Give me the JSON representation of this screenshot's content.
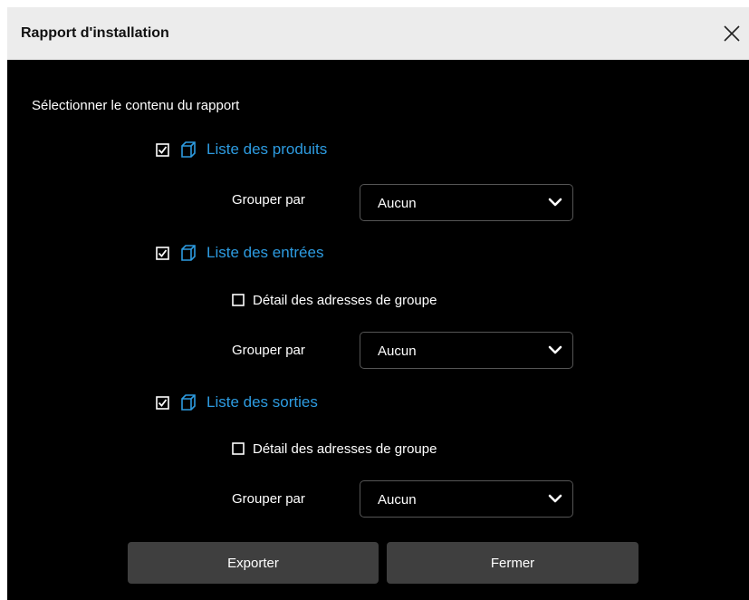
{
  "dialog": {
    "title": "Rapport d'installation",
    "close_icon": "close-icon"
  },
  "main": {
    "instructions": "Sélectionner le contenu du rapport",
    "sections": [
      {
        "label": "Liste des produits",
        "checked": true,
        "icon": "box-icon",
        "group_by_label": "Grouper par",
        "group_by_value": "Aucun"
      },
      {
        "label": "Liste des entrées",
        "checked": true,
        "icon": "box-icon",
        "detail_label": "Détail des adresses de groupe",
        "detail_checked": false,
        "group_by_label": "Grouper par",
        "group_by_value": "Aucun"
      },
      {
        "label": "Liste des sorties",
        "checked": true,
        "icon": "box-icon",
        "detail_label": "Détail des adresses de groupe",
        "detail_checked": false,
        "group_by_label": "Grouper par",
        "group_by_value": "Aucun"
      }
    ]
  },
  "footer": {
    "export_label": "Exporter",
    "close_label": "Fermer"
  },
  "colors": {
    "accent": "#2d9be0",
    "background": "#000000",
    "titlebar": "#ececec",
    "button": "#3f3f3f"
  }
}
